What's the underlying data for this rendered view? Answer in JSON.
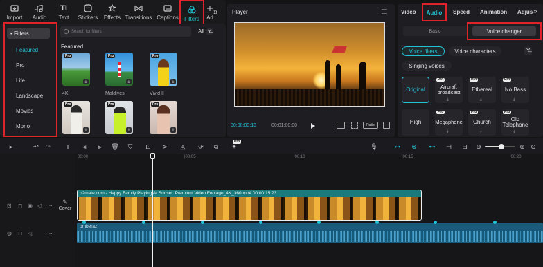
{
  "toolbar": {
    "items": [
      {
        "label": "Import",
        "icon": "import-icon"
      },
      {
        "label": "Audio",
        "icon": "audio-icon"
      },
      {
        "label": "Text",
        "icon": "text-icon"
      },
      {
        "label": "Stickers",
        "icon": "stickers-icon"
      },
      {
        "label": "Effects",
        "icon": "effects-icon"
      },
      {
        "label": "Transitions",
        "icon": "transitions-icon"
      },
      {
        "label": "Captions",
        "icon": "captions-icon"
      },
      {
        "label": "Filters",
        "icon": "filters-icon"
      },
      {
        "label": "Ad",
        "icon": "adjust-icon"
      }
    ],
    "more": "»"
  },
  "filters": {
    "header": "• Filters",
    "categories": [
      "Featured",
      "Pro",
      "Life",
      "Landscape",
      "Movies",
      "Mono"
    ],
    "search_placeholder": "Search for filters",
    "all_label": "All",
    "section_title": "Featured",
    "thumbs": [
      {
        "label": "4K",
        "pro": "Pro"
      },
      {
        "label": "Maldives",
        "pro": "Pro"
      },
      {
        "label": "Vivid II",
        "pro": "Pro"
      },
      {
        "label": "",
        "pro": "Pro"
      },
      {
        "label": "",
        "pro": "Pro"
      },
      {
        "label": "",
        "pro": "Pro"
      }
    ]
  },
  "player": {
    "title": "Player",
    "current_time": "00:00:03:13",
    "total_time": "00:01:00:00",
    "ratio_label": "Ratio",
    "full_label": "Full"
  },
  "right_panel": {
    "tabs": [
      "Video",
      "Audio",
      "Speed",
      "Animation",
      "Adjus"
    ],
    "subtabs": [
      "Basic",
      "Voice changer"
    ],
    "filter_tabs": [
      "Voice filters",
      "Voice characters"
    ],
    "singing_label": "Singing voices",
    "voices_row1": [
      "Original",
      "Aircraft broadcast",
      "Ethereal",
      "No Bass"
    ],
    "voices_row2": [
      "High",
      "Megaphone",
      "Church",
      "Old Telephone"
    ],
    "pro_badge": "Pro"
  },
  "timeline": {
    "ticks": [
      "00:00",
      "|00:05",
      "|00:10",
      "|00:15",
      "|00:20"
    ],
    "video_clip_label": "p2mate.com - Happy Family Playing At Sunset: Premium Video Footage_4K_360.mp4   00:00:15:23",
    "cover_label": "Cover",
    "audio_clip_label": "omberaz",
    "playhead_time": "00:00:03:13",
    "zoom_fraction": 0.55
  },
  "colors": {
    "accent": "#22c3d4",
    "highlight": "#e0222a",
    "clip": "#1a7a7c",
    "audio": "#1a5a7a"
  }
}
